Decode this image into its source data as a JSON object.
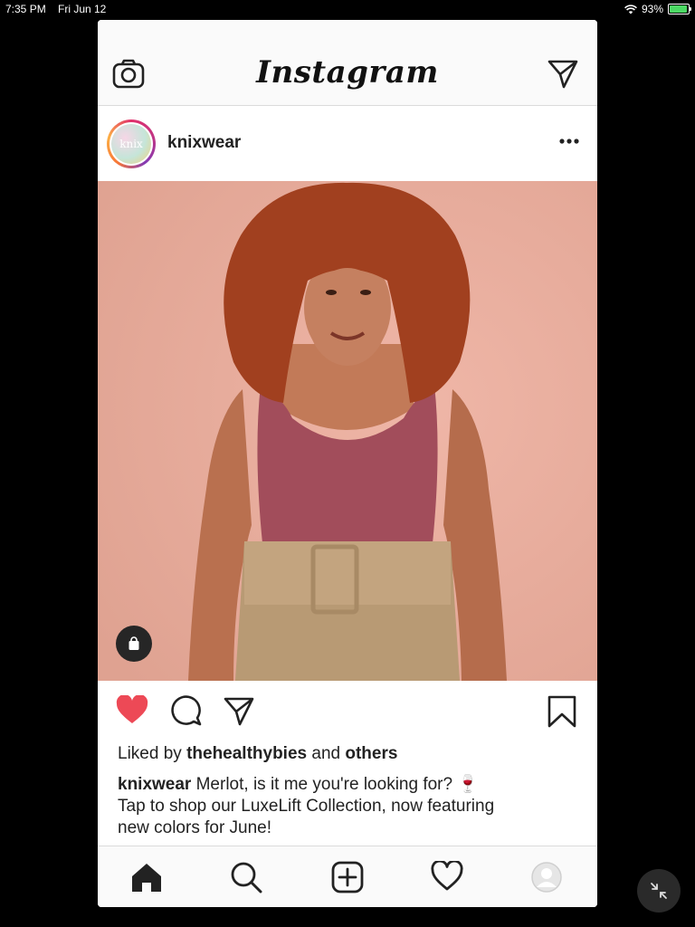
{
  "status_bar": {
    "time": "7:35 PM",
    "date": "Fri Jun 12",
    "battery": "93%",
    "battery_level": 0.93
  },
  "header": {
    "logo": "Instagram",
    "camera_icon": "camera-icon",
    "dm_icon": "paper-plane-icon"
  },
  "post": {
    "avatar_text": "knix",
    "username": "knixwear",
    "more_icon": "more-horizontal-icon",
    "shop_icon": "shopping-bag-icon",
    "liked_prefix": "Liked by",
    "liked_user": "thehealthybies",
    "liked_and": "and",
    "liked_others": "others",
    "caption_user": "knixwear",
    "caption_line1": "Merlot, is it me you're looking for? 🍷",
    "caption_line2": "Tap to shop our LuxeLift Collection, now featuring",
    "caption_line3": "new colors for June!"
  },
  "actions": [
    "heart-filled-icon",
    "comment-icon",
    "share-icon",
    "bookmark-icon"
  ],
  "tabs": [
    "home-icon",
    "search-icon",
    "add-post-icon",
    "activity-heart-icon",
    "profile-icon"
  ],
  "colors": {
    "like": "#ed4956",
    "text": "#222222",
    "header_bg": "#fafafa",
    "border": "#dbdbdb"
  }
}
